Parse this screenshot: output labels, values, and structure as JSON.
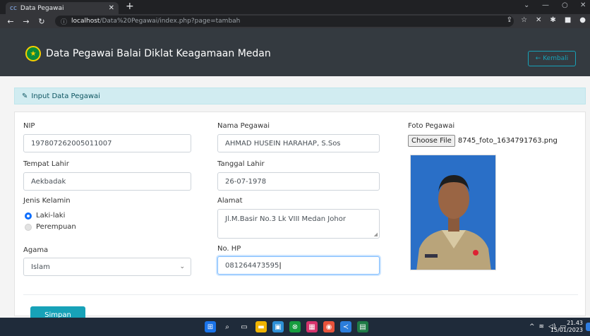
{
  "browser": {
    "tab_title": "Data Pegawai",
    "url_host": "localhost",
    "url_path": "/Data%20Pegawai/index.php?page=tambah"
  },
  "navbar": {
    "brand": "Data Pegawai Balai Diklat Keagamaan Medan",
    "back_label": "← Kembali"
  },
  "card": {
    "header": "Input Data Pegawai"
  },
  "form": {
    "nip": {
      "label": "NIP",
      "value": "197807262005011007"
    },
    "nama": {
      "label": "Nama Pegawai",
      "value": "AHMAD HUSEIN HARAHAP, S.Sos"
    },
    "foto": {
      "label": "Foto Pegawai",
      "button": "Choose File",
      "filename": "8745_foto_1634791763.png"
    },
    "tempat_lahir": {
      "label": "Tempat Lahir",
      "value": "Aekbadak"
    },
    "tanggal_lahir": {
      "label": "Tanggal Lahir",
      "value": "26-07-1978"
    },
    "jenis_kelamin": {
      "label": "Jenis Kelamin",
      "options": [
        "Laki-laki",
        "Perempuan"
      ],
      "selected": "Laki-laki"
    },
    "alamat": {
      "label": "Alamat",
      "value": "Jl.M.Basir No.3 Lk VIII Medan Johor"
    },
    "agama": {
      "label": "Agama",
      "value": "Islam"
    },
    "no_hp": {
      "label": "No. HP",
      "value": "081264473595"
    },
    "save_label": "Simpan"
  },
  "taskbar": {
    "time": "21.43",
    "date": "15/01/2023"
  },
  "colors": {
    "navbar": "#343a40",
    "info": "#17a2b8",
    "alert_bg": "#d1ecf1",
    "radio_on": "#0d6efd"
  }
}
